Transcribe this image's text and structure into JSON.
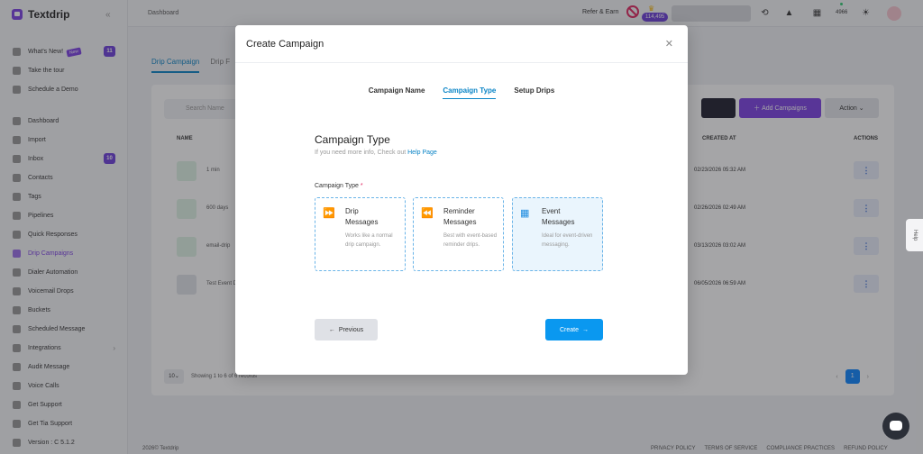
{
  "app": {
    "name": "Textdrip",
    "collapse_icon": "double-chevron-left-icon"
  },
  "sidebar": {
    "items": [
      {
        "label": "What's New!",
        "icon": "star-icon",
        "badge": "11",
        "tag": "New"
      },
      {
        "label": "Take the tour",
        "icon": "clock-icon"
      },
      {
        "label": "Schedule a Demo",
        "icon": "calendar-icon"
      },
      {
        "label": "Dashboard",
        "icon": "dashboard-icon"
      },
      {
        "label": "Import",
        "icon": "import-icon"
      },
      {
        "label": "Inbox",
        "icon": "inbox-icon",
        "badge": "10"
      },
      {
        "label": "Contacts",
        "icon": "contacts-icon"
      },
      {
        "label": "Tags",
        "icon": "tag-icon"
      },
      {
        "label": "Pipelines",
        "icon": "pipeline-icon"
      },
      {
        "label": "Quick Responses",
        "icon": "bolt-icon"
      },
      {
        "label": "Drip Campaigns",
        "icon": "drip-icon",
        "active": true
      },
      {
        "label": "Dialer Automation",
        "icon": "dialer-icon"
      },
      {
        "label": "Voicemail Drops",
        "icon": "voicemail-icon"
      },
      {
        "label": "Buckets",
        "icon": "bucket-icon"
      },
      {
        "label": "Scheduled Message",
        "icon": "schedule-icon"
      },
      {
        "label": "Integrations",
        "icon": "integrations-icon",
        "has_chevron": true
      },
      {
        "label": "Audit Message",
        "icon": "audit-icon"
      },
      {
        "label": "Voice Calls",
        "icon": "phone-icon"
      },
      {
        "label": "Get Support",
        "icon": "support-icon"
      },
      {
        "label": "Get Tia Support",
        "icon": "chat-icon"
      },
      {
        "label": "Version : C 5.1.2",
        "icon": "info-icon"
      }
    ]
  },
  "topbar": {
    "breadcrumb": "Dashboard",
    "refer_label": "Refer & Earn",
    "credits": "114,495",
    "count": "4966",
    "icons": [
      "history-icon",
      "bell-icon",
      "qr-icon",
      "sun-icon"
    ]
  },
  "main": {
    "tabs": [
      "Drip Campaign",
      "Drip F"
    ],
    "search_placeholder": "Search Name",
    "add_label": "Add Campaigns",
    "action_label": "Action",
    "columns": {
      "name": "NAME",
      "created": "CREATED AT",
      "actions": "ACTIONS"
    },
    "rows": [
      {
        "name": "1 min",
        "created": "02/23/2026 05:32 AM"
      },
      {
        "name": "600 days",
        "created": "02/26/2026 02:49 AM"
      },
      {
        "name": "email-drip",
        "created": "03/13/2026 03:02 AM"
      },
      {
        "name": "Test Event D",
        "created": "06/05/2026 06:59 AM"
      }
    ],
    "per_page": "10",
    "records": "Showing 1 to 6 of 6 records",
    "page": "1"
  },
  "footer": {
    "copyright": "2026© Textdrip",
    "links": [
      "PRIVACY POLICY",
      "TERMS OF SERVICE",
      "COMPLIANCE PRACTICES",
      "REFUND POLICY"
    ]
  },
  "help_tab": "Help",
  "modal": {
    "title": "Create Campaign",
    "steps": [
      "Campaign Name",
      "Campaign Type",
      "Setup Drips"
    ],
    "active_step": 1,
    "section_title": "Campaign Type",
    "help_prefix": "If you need more info, Check out",
    "help_link": "Help Page",
    "field_label": "Campaign Type",
    "required_mark": "*",
    "types": [
      {
        "title_line1": "Drip",
        "title_line2": "Messages",
        "desc": "Works like a normal drip campaign.",
        "icon": "fast-forward-icon"
      },
      {
        "title_line1": "Reminder",
        "title_line2": "Messages",
        "desc": "Best with event-based reminder drips.",
        "icon": "rewind-icon"
      },
      {
        "title_line1": "Event",
        "title_line2": "Messages",
        "desc": "Ideal for event-driven messaging.",
        "icon": "calendar-icon",
        "selected": true
      }
    ],
    "previous_label": "Previous",
    "create_label": "Create"
  },
  "colors": {
    "accent": "#7b3fe4",
    "primary": "#0a98f0",
    "link": "#0a84c6"
  }
}
